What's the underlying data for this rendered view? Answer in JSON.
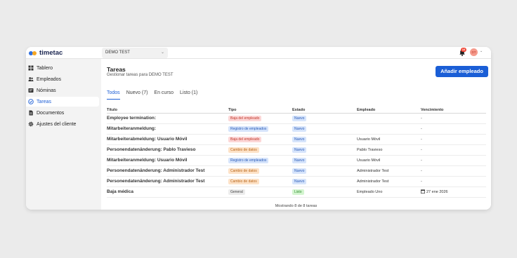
{
  "app": {
    "logo_text": "timetac",
    "company": "DEMO TEST",
    "notification_count": "10",
    "avatar_initials": "DT"
  },
  "sidebar": {
    "items": [
      {
        "label": "Tablero",
        "icon": "grid-icon",
        "active": false
      },
      {
        "label": "Empleados",
        "icon": "people-icon",
        "active": false
      },
      {
        "label": "Nóminas",
        "icon": "payroll-icon",
        "active": false
      },
      {
        "label": "Tareas",
        "icon": "check-circle-icon",
        "active": true
      },
      {
        "label": "Documentos",
        "icon": "document-icon",
        "active": false
      },
      {
        "label": "Ajustes del cliente",
        "icon": "gear-icon",
        "active": false
      }
    ]
  },
  "page": {
    "title": "Tareas",
    "subtitle": "Gestionar tareas para DEMO TEST",
    "add_button": "Añadir empleado",
    "tabs": [
      "Todos",
      "Nuevo (7)",
      "En curso",
      "Listo (1)"
    ],
    "active_tab": 0
  },
  "table": {
    "columns": [
      "Título",
      "Tipo",
      "Estado",
      "Empleado",
      "Vencimiento"
    ],
    "rows": [
      {
        "title": "Employee termination:",
        "type": "Baja del empleado",
        "status": "Nuevo",
        "employee": "",
        "due": "-"
      },
      {
        "title": "Mitarbeiteranmeldung:",
        "type": "Registro de empleados",
        "status": "Nuevo",
        "employee": "",
        "due": "-"
      },
      {
        "title": "Mitarbeiterabmeldung: Usuario Móvil",
        "type": "Baja del empleado",
        "status": "Nuevo",
        "employee": "Usuario Móvil",
        "due": "-"
      },
      {
        "title": "Personendatenänderung: Pablo Travieso",
        "type": "Cambio de datos",
        "status": "Nuevo",
        "employee": "Pablo Travieso",
        "due": "-"
      },
      {
        "title": "Mitarbeiteranmeldung: Usuario Móvil",
        "type": "Registro de empleados",
        "status": "Nuevo",
        "employee": "Usuario Móvil",
        "due": "-"
      },
      {
        "title": "Personendatenänderung: Administrador Test",
        "type": "Cambio de datos",
        "status": "Nuevo",
        "employee": "Administrador Test",
        "due": "-"
      },
      {
        "title": "Personendatenänderung: Administrador Test",
        "type": "Cambio de datos",
        "status": "Nuevo",
        "employee": "Administrador Test",
        "due": "-"
      },
      {
        "title": "Baja médica",
        "type": "General",
        "status": "Listo",
        "employee": "Empleado Uno",
        "due": "27 ene 2026"
      }
    ],
    "footer": "Mostrando 8 de 8 tareas"
  },
  "colors": {
    "accent": "#1a5ed6",
    "type_baja": {
      "bg": "#fcd7d7",
      "fg": "#c0392b"
    },
    "type_registro": {
      "bg": "#d6e4fb",
      "fg": "#2a5bb8"
    },
    "type_cambio": {
      "bg": "#fde2c7",
      "fg": "#b8661a"
    },
    "type_general": {
      "bg": "#ececec",
      "fg": "#444444"
    },
    "status_nuevo": {
      "bg": "#d6e4fb",
      "fg": "#2a5bb8"
    },
    "status_listo": {
      "bg": "#d4f5d0",
      "fg": "#2e8b2e"
    }
  }
}
